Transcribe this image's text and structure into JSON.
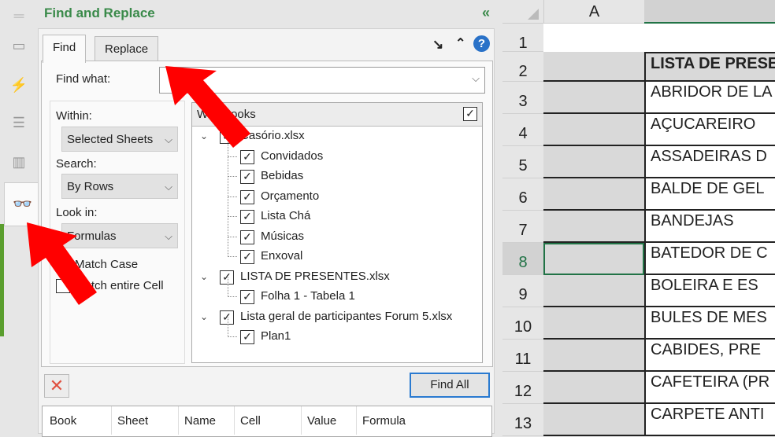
{
  "panel": {
    "title": "Find and Replace",
    "collapse_icon": "double-chevron-left"
  },
  "tabs": [
    {
      "label": "Find",
      "active": true
    },
    {
      "label": "Replace",
      "active": false
    }
  ],
  "find": {
    "label": "Find what:",
    "value": ""
  },
  "options": {
    "within_label": "Within:",
    "within_value": "Selected Sheets",
    "search_label": "Search:",
    "search_value": "By Rows",
    "lookin_label": "Look in:",
    "lookin_value": "Formulas",
    "match_case": {
      "label": "Match Case",
      "checked": true
    },
    "match_entire": {
      "label": "Match entire Cell",
      "checked": false
    }
  },
  "tree": {
    "header": "Workbooks",
    "items": [
      {
        "label": "Casório.xlsx",
        "level": 0
      },
      {
        "label": "Convidados",
        "level": 1
      },
      {
        "label": "Bebidas",
        "level": 1
      },
      {
        "label": "Orçamento",
        "level": 1
      },
      {
        "label": "Lista Chá",
        "level": 1
      },
      {
        "label": "Músicas",
        "level": 1
      },
      {
        "label": "Enxoval",
        "level": 1
      },
      {
        "label": "LISTA DE PRESENTES.xlsx",
        "level": 0
      },
      {
        "label": "Folha 1 - Tabela 1",
        "level": 1
      },
      {
        "label": "Lista geral de participantes Forum 5.xlsx",
        "level": 0
      },
      {
        "label": "Plan1",
        "level": 1
      }
    ]
  },
  "buttons": {
    "find_all": "Find All"
  },
  "results": {
    "columns": [
      "Book",
      "Sheet",
      "Name",
      "Cell",
      "Value",
      "Formula"
    ]
  },
  "sheet": {
    "col_a": "A",
    "selected_row": "8",
    "rows": [
      {
        "n": "1",
        "b": ""
      },
      {
        "n": "2",
        "b": "LISTA DE PRESENTES"
      },
      {
        "n": "3",
        "b": "ABRIDOR DE LA"
      },
      {
        "n": "4",
        "b": "AÇUCAREIRO"
      },
      {
        "n": "5",
        "b": "ASSADEIRAS D"
      },
      {
        "n": "6",
        "b": "BALDE DE GEL"
      },
      {
        "n": "7",
        "b": "BANDEJAS"
      },
      {
        "n": "8",
        "b": "BATEDOR DE C"
      },
      {
        "n": "9",
        "b": "BOLEIRA  E ES"
      },
      {
        "n": "10",
        "b": "BULES DE MES"
      },
      {
        "n": "11",
        "b": "CABIDES, PRE"
      },
      {
        "n": "12",
        "b": "CAFETEIRA (PR"
      },
      {
        "n": "13",
        "b": "CARPETE ANTI"
      }
    ]
  }
}
